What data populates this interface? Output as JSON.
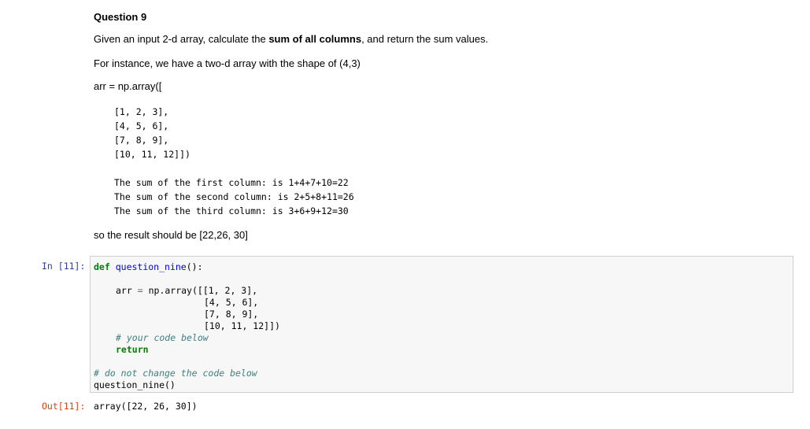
{
  "markdown": {
    "heading": "Question 9",
    "intro_prefix": "Given an input 2-d array, calculate the ",
    "intro_bold": "sum of all columns",
    "intro_suffix": ", and return the sum values.",
    "instance": "For instance, we have a two-d array with the shape of (4,3)",
    "arr_line": "arr = np.array([",
    "array_rows": [
      "[1, 2, 3],",
      "[4, 5, 6],",
      "[7, 8, 9],",
      "[10, 11, 12]])"
    ],
    "sum_lines": [
      "The sum of the first column: is 1+4+7+10=22",
      "The sum of the second column: is 2+5+8+11=26",
      "The sum of the third column: is 3+6+9+12=30"
    ],
    "result": "so the result should be [22,26, 30]"
  },
  "code_cell": {
    "prompt": "In [11]:",
    "def_kw": "def",
    "func_name": "question_nine",
    "def_tail": "():",
    "arr_var": "arr",
    "arr_eq": "=",
    "arr_call": "np.array([[1, 2, 3],",
    "arr_rows": [
      "[4, 5, 6],",
      "[7, 8, 9],",
      "[10, 11, 12]])"
    ],
    "comment_your_code": "# your code below",
    "return_kw": "return",
    "comment_do_not_change": "# do not change the code below",
    "call_line": "question_nine()"
  },
  "output_cell": {
    "prompt": "Out[11]:",
    "value": "array([22, 26, 30])"
  }
}
